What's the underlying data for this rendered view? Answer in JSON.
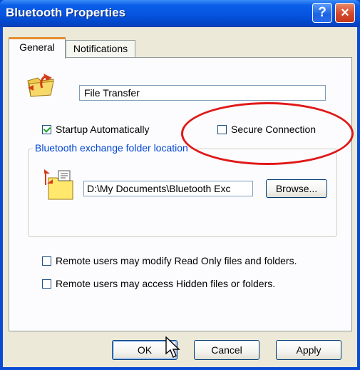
{
  "window": {
    "title": "Bluetooth Properties",
    "help_icon": "?",
    "close_icon": "×"
  },
  "tabs": [
    {
      "label": "General",
      "selected": true
    },
    {
      "label": "Notifications",
      "selected": false
    }
  ],
  "general": {
    "name_value": "File Transfer",
    "startup_label": "Startup Automatically",
    "startup_checked": true,
    "secure_label": "Secure Connection",
    "secure_checked": false,
    "folder_group_label": "Bluetooth exchange folder location",
    "folder_path": "D:\\My Documents\\Bluetooth Exc",
    "browse_label": "Browse...",
    "readonly_label": "Remote users may modify Read Only files and folders.",
    "readonly_checked": false,
    "hidden_label": "Remote users may access Hidden files or folders.",
    "hidden_checked": false
  },
  "buttons": {
    "ok": "OK",
    "cancel": "Cancel",
    "apply": "Apply"
  },
  "annotation": {
    "highlight_color": "#e01818"
  }
}
